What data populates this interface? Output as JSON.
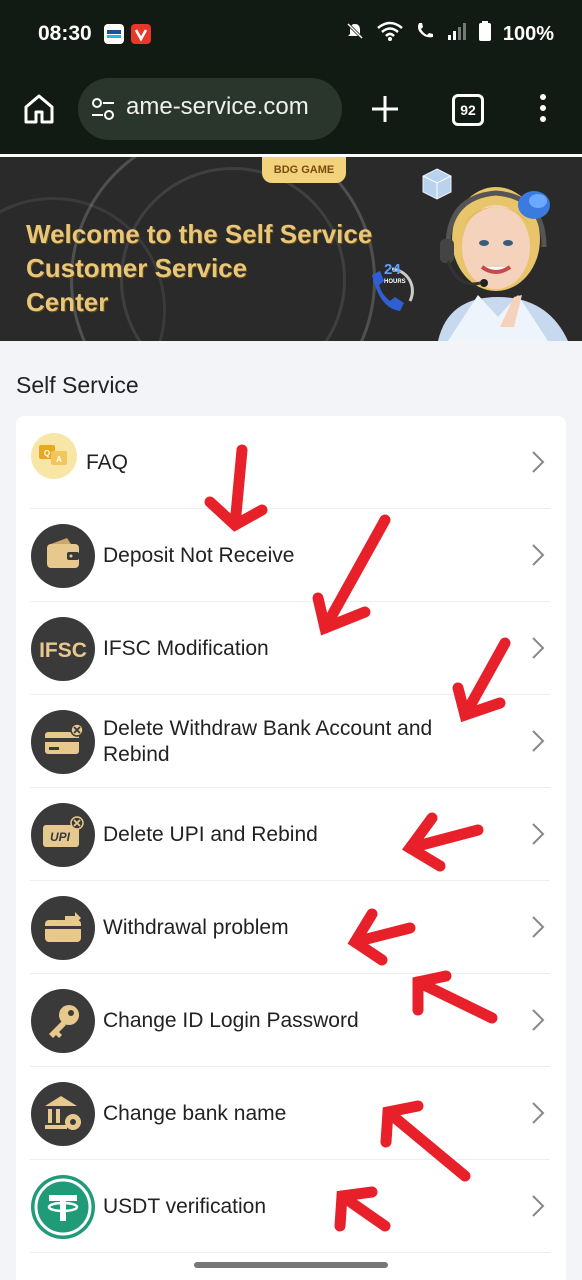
{
  "status_bar": {
    "time": "08:30",
    "battery": "100%",
    "icons": [
      "paytm-icon",
      "vivaldi-icon",
      "mute-bell-icon",
      "wifi-icon",
      "wifi-call-icon",
      "signal-icon",
      "battery-icon"
    ]
  },
  "browser": {
    "url": "ame-service.com",
    "tab_count": "92"
  },
  "banner": {
    "badge": "BDG GAME",
    "title_line1": "Welcome to the Self Service",
    "title_line2": "Customer Service",
    "title_line3": "Center",
    "hours_number": "24",
    "hours_label": "HOURS"
  },
  "section_title": "Self Service",
  "items": [
    {
      "label": "FAQ",
      "icon": "faq-icon"
    },
    {
      "label": "Deposit Not Receive",
      "icon": "wallet-icon"
    },
    {
      "label": "IFSC Modification",
      "icon": "ifsc-icon"
    },
    {
      "label": "Delete Withdraw Bank Account and Rebind",
      "icon": "card-delete-icon"
    },
    {
      "label": "Delete UPI and Rebind",
      "icon": "upi-delete-icon"
    },
    {
      "label": "Withdrawal problem",
      "icon": "withdraw-icon"
    },
    {
      "label": "Change ID Login Password",
      "icon": "key-icon"
    },
    {
      "label": "Change bank name",
      "icon": "bank-settings-icon"
    },
    {
      "label": "USDT verification",
      "icon": "usdt-icon"
    }
  ],
  "colors": {
    "status_bg": "#111a13",
    "banner_text": "#e9c77a",
    "annotation_red": "#e8202a",
    "icon_gold": "#e7c98e"
  }
}
